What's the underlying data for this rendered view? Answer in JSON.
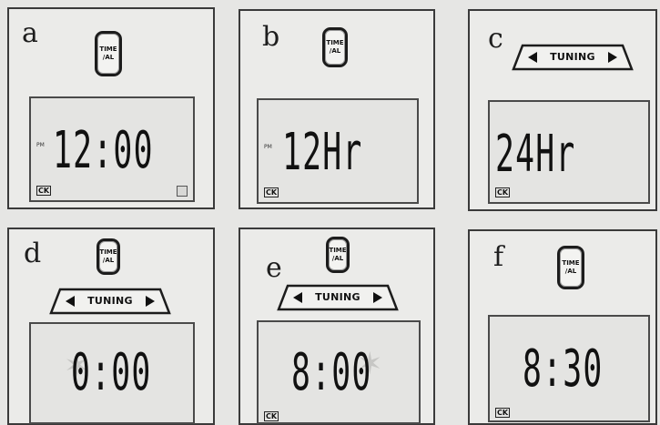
{
  "panels": {
    "a": {
      "letter": "a",
      "button": [
        "TIME",
        "/AL"
      ],
      "display": "12:00",
      "pm": "PM",
      "ck": "CK"
    },
    "b": {
      "letter": "b",
      "button": [
        "TIME",
        "/AL"
      ],
      "display": "12Hr",
      "pm": "PM",
      "ck": "CK"
    },
    "c": {
      "letter": "c",
      "tuning": "TUNING",
      "display": "24Hr",
      "ck": "CK"
    },
    "d": {
      "letter": "d",
      "button": [
        "TIME",
        "/AL"
      ],
      "tuning": "TUNING",
      "display": "0:00",
      "ck": "CK"
    },
    "e": {
      "letter": "e",
      "button": [
        "TIME",
        "/AL"
      ],
      "tuning": "TUNING",
      "display": "8:00",
      "ck": "CK"
    },
    "f": {
      "letter": "f",
      "button": [
        "TIME",
        "/AL"
      ],
      "display": "8:30",
      "ck": "CK"
    }
  },
  "icons": {
    "tuning_left": "left-triangle-icon",
    "tuning_right": "right-triangle-icon",
    "flash": "flash-star-icon"
  }
}
